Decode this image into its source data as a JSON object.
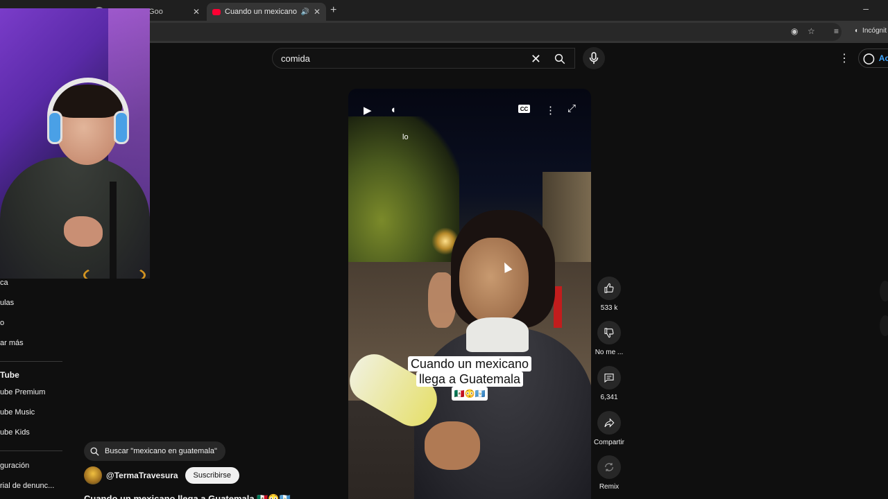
{
  "browser": {
    "tabs": [
      {
        "label": "…",
        "active": false
      },
      {
        "label": "Buscar con Goo",
        "active": false
      },
      {
        "label": "Cuando un mexicano llega",
        "active": true
      }
    ],
    "incognito_label": "Incógnit"
  },
  "header": {
    "search_value": "comida",
    "signin_label": "Ac"
  },
  "sidebar": {
    "items": [
      {
        "label": "ca"
      },
      {
        "label": "ulas"
      },
      {
        "label": "o"
      },
      {
        "label": "ar más"
      }
    ],
    "section_title": "Tube",
    "section_items": [
      {
        "label": "ube Premium"
      },
      {
        "label": "ube Music"
      },
      {
        "label": "ube Kids"
      }
    ],
    "footer_items": [
      {
        "label": "guración"
      },
      {
        "label": "rial de denunc..."
      }
    ]
  },
  "video": {
    "top_caption": "lo",
    "caption_line1": "Cuando un mexicano",
    "caption_line2": "llega a Guatemala",
    "caption_emojis": "🇲🇽😳🇬🇹",
    "cc_label": "CC"
  },
  "actions": {
    "like_count": "533 k",
    "dislike_label": "No me ...",
    "comments_count": "6,341",
    "share_label": "Compartir",
    "remix_label": "Remix"
  },
  "channel": {
    "suggest_search": "Buscar \"mexicano en guatemala\"",
    "handle": "@TermaTravesura",
    "subscribe_label": "Suscribirse",
    "title": "Cuando un mexicano llega a Guatemala 🇲🇽😳🇬🇹"
  },
  "colors": {
    "background": "#0f0f0f",
    "link_blue": "#3ea6ff",
    "youtube_red": "#ff0033"
  }
}
